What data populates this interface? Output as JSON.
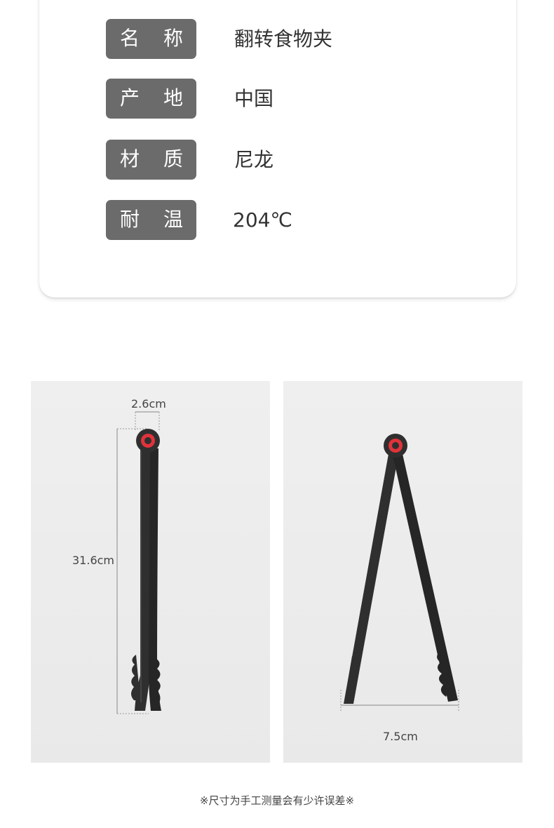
{
  "specs": [
    {
      "label_1": "名",
      "label_2": "称",
      "value": "翻转食物夹"
    },
    {
      "label_1": "产",
      "label_2": "地",
      "value": "中国"
    },
    {
      "label_1": "材",
      "label_2": "质",
      "value": "尼龙"
    },
    {
      "label_1": "耐",
      "label_2": "温",
      "value": "204℃"
    }
  ],
  "dimensions": {
    "width_closed": "2.6cm",
    "length": "31.6cm",
    "width_open": "7.5cm"
  },
  "colors": {
    "label_bg": "#6b6b6b",
    "tongs": "#2f2f2f",
    "ring_accent": "#e0333b"
  },
  "footnote": "※尺寸为手工测量会有少许误差※"
}
